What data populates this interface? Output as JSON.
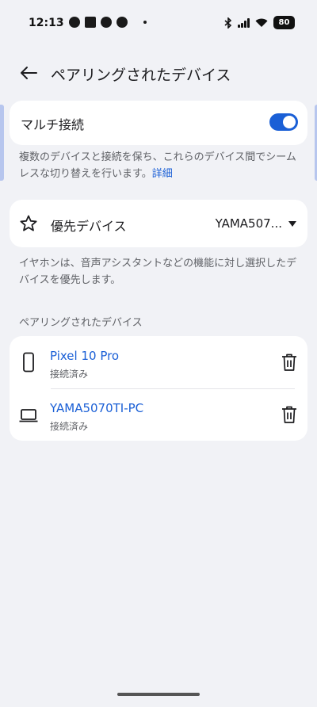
{
  "status_bar": {
    "time": "12:13",
    "battery": "80"
  },
  "header": {
    "title": "ペアリングされたデバイス"
  },
  "multi_connect": {
    "label": "マルチ接続",
    "enabled": true,
    "description": "複数のデバイスと接続を保ち、これらのデバイス間でシームレスな切り替えを行います。",
    "link": "詳細"
  },
  "priority": {
    "label": "優先デバイス",
    "value": "YAMA507...",
    "description": "イヤホンは、音声アシスタントなどの機能に対し選択したデバイスを優先します。"
  },
  "paired": {
    "section_label": "ペアリングされたデバイス",
    "devices": [
      {
        "name": "Pixel 10 Pro",
        "status": "接続済み",
        "icon": "phone-icon"
      },
      {
        "name": "YAMA5070TI-PC",
        "status": "接続済み",
        "icon": "laptop-icon"
      }
    ]
  },
  "colors": {
    "accent": "#1a5fd6",
    "background": "#f1f2f6"
  }
}
